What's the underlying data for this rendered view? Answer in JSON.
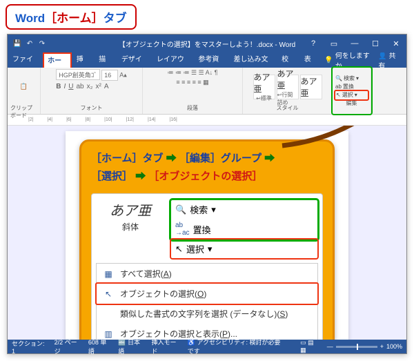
{
  "header": {
    "word": "Word",
    "bracket_open": "［",
    "home": "ホーム",
    "bracket_close": "］",
    "tab": "タブ"
  },
  "titlebar": {
    "title": "【オブジェクトの選択】をマスターしよう！.docx  -  Word"
  },
  "menubar": {
    "file": "ファイル",
    "home": "ホーム",
    "insert": "挿入",
    "draw": "描画",
    "design": "デザイン",
    "layout": "レイアウト",
    "references": "参考資料",
    "mailings": "差し込み文書",
    "review": "校閲",
    "view": "表示",
    "tell": "何をしますか",
    "share": "共有"
  },
  "ribbon": {
    "clipboard": {
      "label": "クリップボード",
      "paste": "貼り付け"
    },
    "font": {
      "label": "フォント",
      "name": "HGP創英角ｺﾞ",
      "size": "16"
    },
    "paragraph": {
      "label": "段落"
    },
    "styles": {
      "label": "スタイル",
      "aa": "あア亜",
      "s1": "↩標準",
      "s2": "↩行間詰め"
    },
    "editing": {
      "label": "編集",
      "find": "検索",
      "replace": "置換",
      "select": "選択"
    }
  },
  "instruction": {
    "l1a": "［ホーム］タブ",
    "l1b": "［編集］グループ",
    "l2a": "［選択］",
    "l2b": "［オブジェクトの選択］",
    "arrow": "➡"
  },
  "zoom_panel": {
    "sample": "あア亜",
    "sample_label": "斜体",
    "find": "検索",
    "replace": "置換",
    "select": "選択"
  },
  "menu": {
    "select_all": "すべて選択(",
    "select_all_k": "A",
    "select_obj": "オブジェクトの選択(",
    "select_obj_k": "O",
    "similar": "類似した書式の文字列を選択 (データなし)(",
    "similar_k": "S",
    "pane": "オブジェクトの選択と表示(",
    "pane_k": "P",
    "close": ")",
    "ellipsis": ")..."
  },
  "status": {
    "section": "セクション:  1",
    "page": "2/2 ページ",
    "words": "608 単語",
    "lang": "日本語",
    "mode": "挿入モード",
    "acc": "アクセシビリティ: 検討が必要です",
    "zoom": "100%"
  }
}
